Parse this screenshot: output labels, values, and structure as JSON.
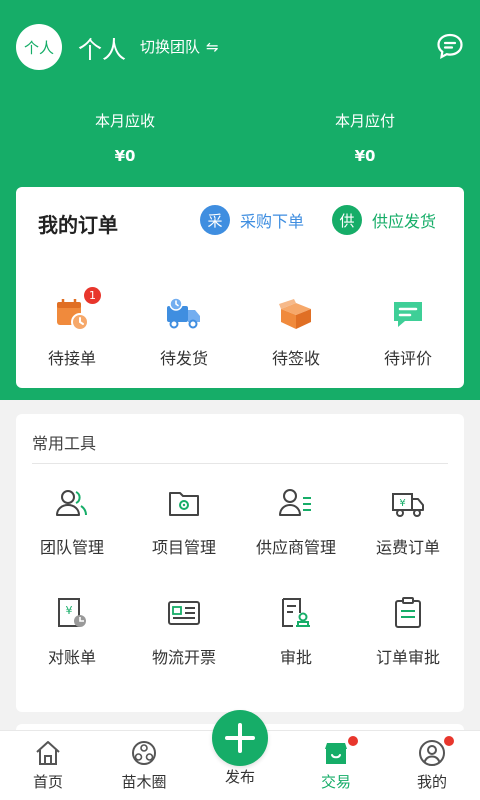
{
  "header": {
    "avatar_text": "个人",
    "title": "个人",
    "switch_team": "切换团队",
    "switch_icon": "⇋",
    "receivable_label": "本月应收",
    "receivable_value": "¥0",
    "payable_label": "本月应付",
    "payable_value": "¥0"
  },
  "orders": {
    "title": "我的订单",
    "purchase": {
      "icon_char": "采",
      "label": "采购下单"
    },
    "supply": {
      "icon_char": "供",
      "label": "供应发货"
    },
    "items": [
      {
        "label": "待接单",
        "icon": "calendar-clock-icon",
        "badge": "1"
      },
      {
        "label": "待发货",
        "icon": "delivery-truck-icon"
      },
      {
        "label": "待签收",
        "icon": "open-box-icon"
      },
      {
        "label": "待评价",
        "icon": "comment-icon"
      }
    ]
  },
  "tools": {
    "title": "常用工具",
    "items": [
      {
        "label": "团队管理",
        "icon": "team-icon"
      },
      {
        "label": "项目管理",
        "icon": "folder-gear-icon"
      },
      {
        "label": "供应商管理",
        "icon": "user-list-icon"
      },
      {
        "label": "运费订单",
        "icon": "freight-truck-icon"
      },
      {
        "label": "对账单",
        "icon": "statement-icon"
      },
      {
        "label": "物流开票",
        "icon": "invoice-icon"
      },
      {
        "label": "审批",
        "icon": "approval-stamp-icon"
      },
      {
        "label": "订单审批",
        "icon": "clipboard-icon"
      }
    ]
  },
  "tabbar": {
    "items": [
      {
        "label": "首页",
        "icon": "home-icon"
      },
      {
        "label": "苗木圈",
        "icon": "community-icon"
      },
      {
        "label": "发布",
        "icon": "plus-icon"
      },
      {
        "label": "交易",
        "icon": "shop-icon",
        "active": true
      },
      {
        "label": "我的",
        "icon": "user-icon"
      }
    ]
  },
  "colors": {
    "brand_green": "#16ad68",
    "accent_blue": "#3f8ee0",
    "badge_red": "#e8362c",
    "icon_orange": "#f08a3c"
  }
}
